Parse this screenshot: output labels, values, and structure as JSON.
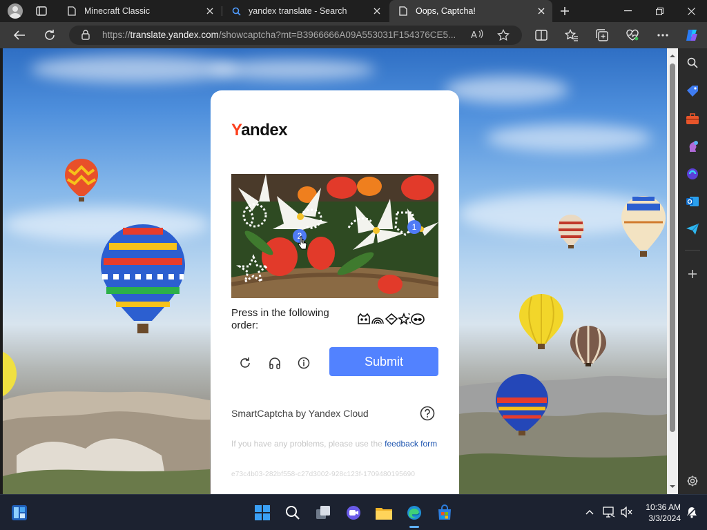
{
  "browser": {
    "tabs": [
      {
        "title": "Minecraft Classic",
        "icon": "page-icon",
        "active": false
      },
      {
        "title": "yandex translate - Search",
        "icon": "search-icon",
        "active": false
      },
      {
        "title": "Oops, Captcha!",
        "icon": "page-icon",
        "active": true
      }
    ],
    "address": {
      "scheme": "https://",
      "host": "translate.yandex.com",
      "path": "/showcaptcha?mt=B3966666A09A553031F154376CE5..."
    },
    "colors": {
      "tabbar": "#1f1f1f",
      "toolbar": "#3a3a3a",
      "accent": "#5282ff"
    }
  },
  "captcha": {
    "logo_first": "Y",
    "logo_rest": "andex",
    "instruction": "Press in the following order:",
    "order_symbols": [
      "cat-face-icon",
      "rainbow-icon",
      "diamond-sparkle-icon",
      "star-sparkle-icon",
      "alien-icon"
    ],
    "marks": [
      {
        "label": "2"
      },
      {
        "label": "1"
      }
    ],
    "submit_label": "Submit",
    "brand_text": "SmartCaptcha by Yandex Cloud",
    "problem_text": "If you have any problems, please use the ",
    "feedback_link": "feedback form",
    "hash": "e73c4b03-282bf558-c27d3002-928c123f-1709480195690"
  },
  "sidebar": {
    "items": [
      "search-icon",
      "tag-icon",
      "briefcase-icon",
      "chess-icon",
      "copilot-icon",
      "outlook-icon",
      "send-icon",
      "add-icon",
      "settings-icon"
    ]
  },
  "taskbar": {
    "apps": [
      "widgets-icon",
      "start-icon",
      "search-icon",
      "task-view-icon",
      "teams-icon",
      "file-explorer-icon",
      "edge-icon",
      "store-icon"
    ],
    "time": "10:36 AM",
    "date": "3/3/2024"
  }
}
